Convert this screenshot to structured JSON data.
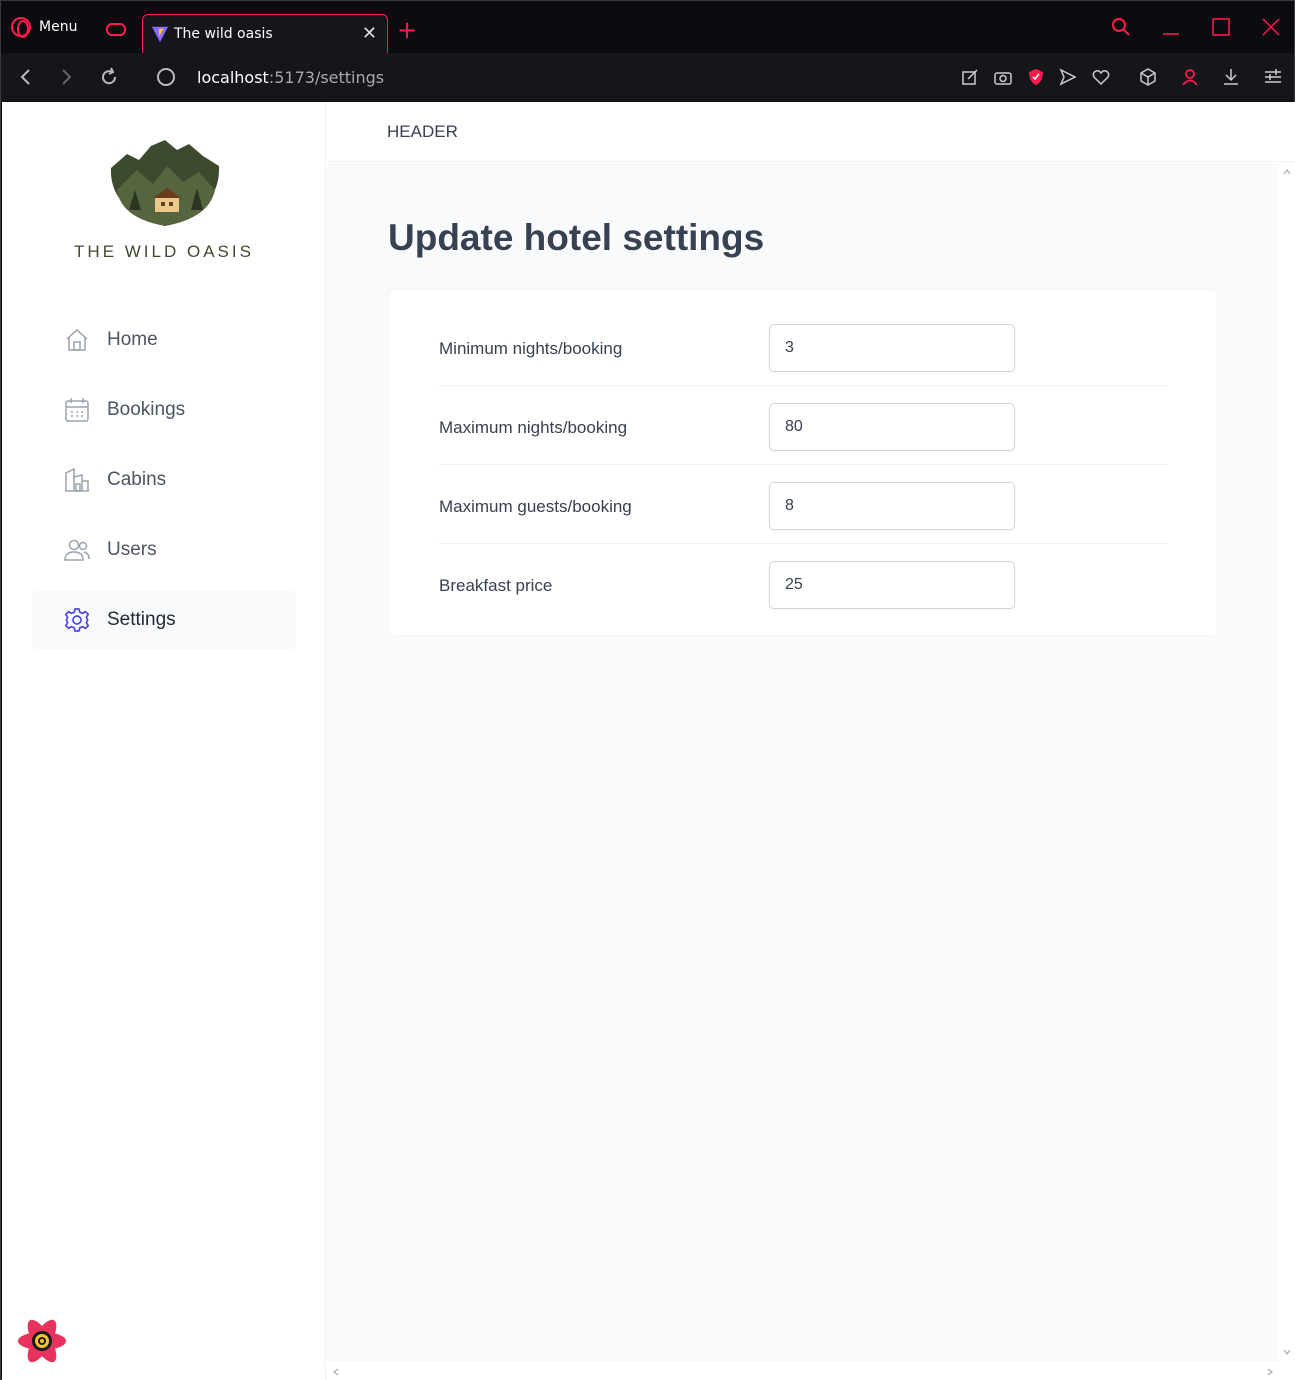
{
  "browser": {
    "menu_label": "Menu",
    "tab_title": "The wild oasis",
    "tab_close": "✕",
    "new_tab": "+",
    "url_host": "localhost",
    "url_path": ":5173/settings",
    "accent": "#ff1b4c"
  },
  "sidebar": {
    "brand": "THE WILD OASIS",
    "items": [
      {
        "label": "Home",
        "icon": "home-icon"
      },
      {
        "label": "Bookings",
        "icon": "calendar-icon"
      },
      {
        "label": "Cabins",
        "icon": "building-icon"
      },
      {
        "label": "Users",
        "icon": "users-icon"
      },
      {
        "label": "Settings",
        "icon": "gear-icon",
        "active": true
      }
    ]
  },
  "header": {
    "title": "HEADER"
  },
  "main": {
    "title": "Update hotel settings",
    "fields": [
      {
        "label": "Minimum nights/booking",
        "value": "3"
      },
      {
        "label": "Maximum nights/booking",
        "value": "80"
      },
      {
        "label": "Maximum guests/booking",
        "value": "8"
      },
      {
        "label": "Breakfast price",
        "value": "25"
      }
    ]
  }
}
